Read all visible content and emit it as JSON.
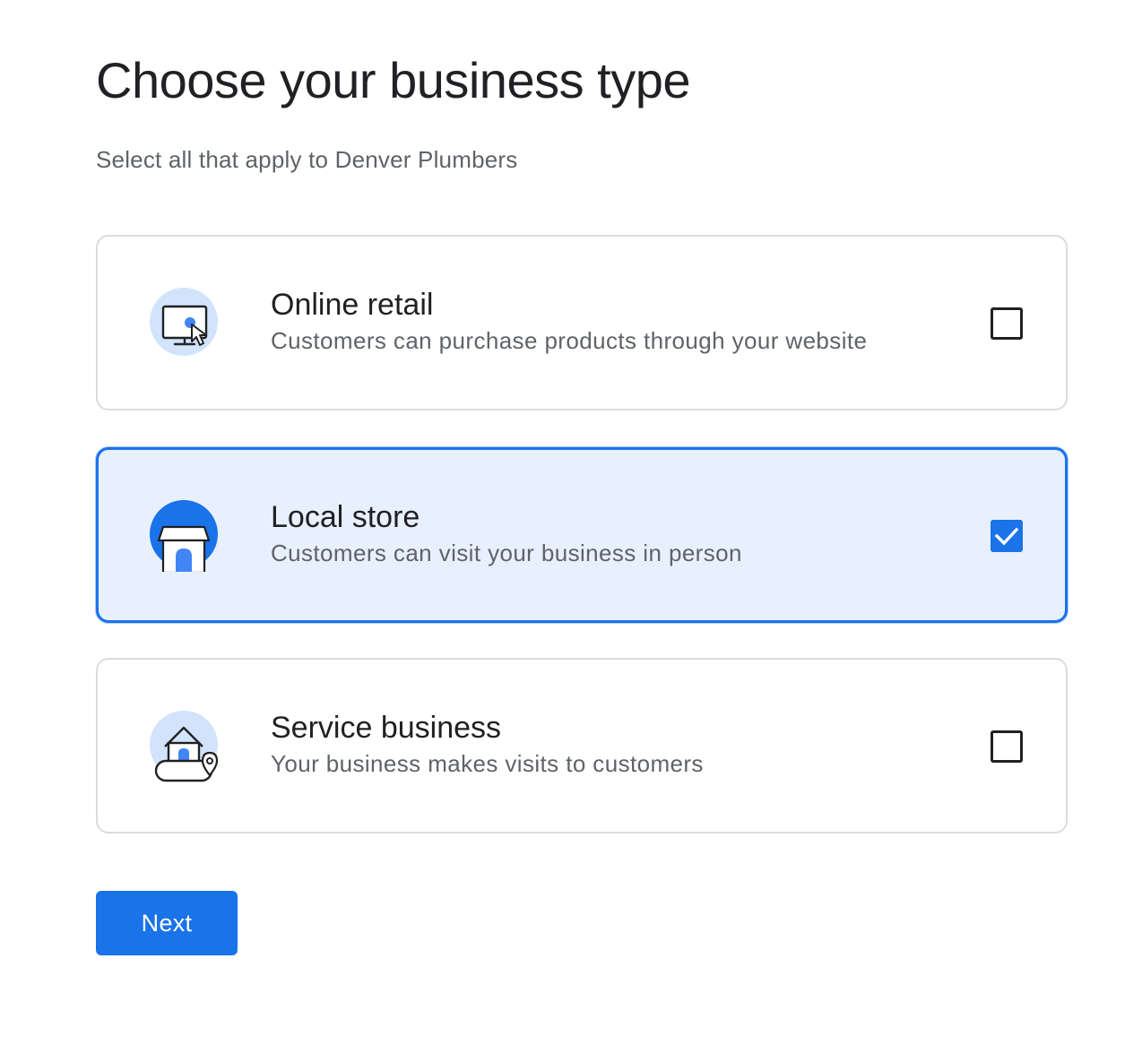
{
  "header": {
    "title": "Choose your business type",
    "subtitle": "Select all that apply to Denver Plumbers"
  },
  "options": [
    {
      "title": "Online retail",
      "description": "Customers can purchase products through your website",
      "icon": "computer-cursor-icon",
      "checked": false
    },
    {
      "title": "Local store",
      "description": "Customers can visit your business in person",
      "icon": "storefront-icon",
      "checked": true
    },
    {
      "title": "Service business",
      "description": "Your business makes visits to customers",
      "icon": "house-location-icon",
      "checked": false
    }
  ],
  "actions": {
    "next_label": "Next"
  },
  "colors": {
    "accent": "#1a73e8",
    "selected_background": "#e8f0fe",
    "icon_circle_light": "#d2e3fc",
    "border": "#dadce0",
    "title_text": "#202124",
    "secondary_text": "#5f6368"
  }
}
